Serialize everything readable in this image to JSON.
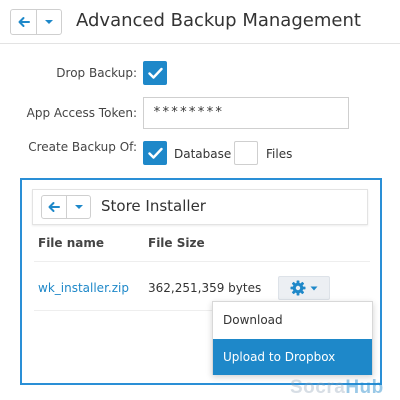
{
  "header": {
    "title": "Advanced Backup Management",
    "back_icon": "arrow-left-icon",
    "menu_icon": "caret-down-icon"
  },
  "form": {
    "drop_backup": {
      "label": "Drop Backup:",
      "checked": true
    },
    "access_token": {
      "label": "App Access Token:",
      "value": "********"
    },
    "create_backup_of": {
      "label": "Create Backup Of:",
      "options": [
        {
          "label": "Database",
          "checked": true
        },
        {
          "label": "Files",
          "checked": false
        }
      ]
    }
  },
  "modal": {
    "title": "Store Installer",
    "columns": [
      "File name",
      "File Size"
    ],
    "rows": [
      {
        "file_name": "wk_installer.zip",
        "file_size": "362,251,359 bytes"
      }
    ],
    "actions_icon": "gear-icon",
    "dropdown": {
      "items": [
        {
          "label": "Download",
          "active": false
        },
        {
          "label": "Upload to Dropbox",
          "active": true
        }
      ]
    }
  },
  "watermark": {
    "part1": "Socra",
    "part2": "Hub"
  },
  "colors": {
    "accent": "#1e88c9",
    "modal_border": "#2a8fd6",
    "active_item_bg": "#1e88c9"
  }
}
